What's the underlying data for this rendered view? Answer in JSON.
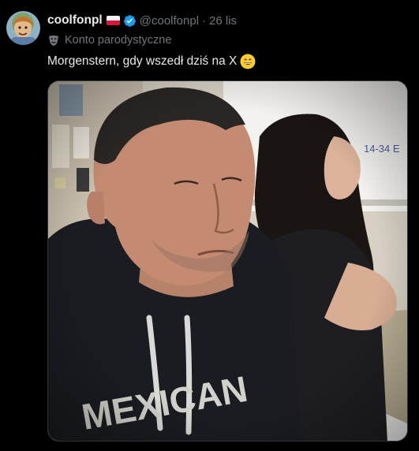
{
  "tweet": {
    "author": {
      "display_name": "coolfonpl",
      "handle": "@coolfonpl",
      "flag_icon": "poland-flag-icon",
      "verified_icon": "verified-badge-icon"
    },
    "separator": "·",
    "timestamp": "26 lis",
    "account_label": "Konto parodystyczne",
    "account_label_icon": "theater-mask-icon",
    "text": "Morgenstern, gdy wszedł dziś na X",
    "emoji": "grinning-face-emoji",
    "media": {
      "type": "photo",
      "jacket_text": "MEXICAN"
    }
  },
  "colors": {
    "background": "#000000",
    "primary_text": "#e7e9ea",
    "secondary_text": "#71767b",
    "verified_blue": "#1d9bf0"
  }
}
